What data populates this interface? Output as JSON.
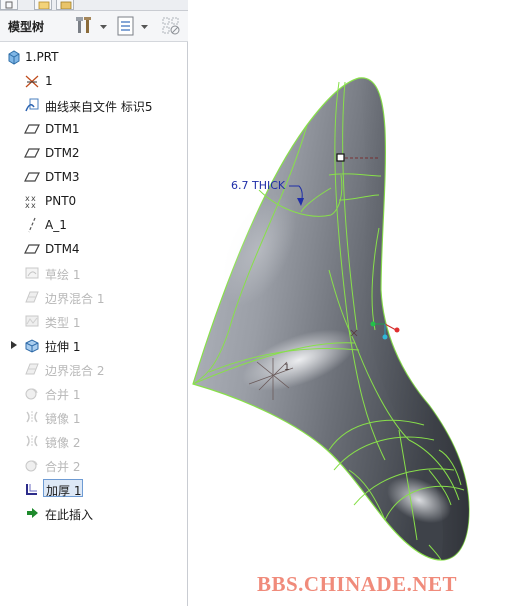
{
  "tree_panel": {
    "title": "模型树",
    "toolbar_icons": [
      "tools-icon",
      "dropdown-arrow-icon",
      "tree-display-icon",
      "dropdown-arrow-icon",
      "filter-icon"
    ],
    "items": [
      {
        "label": "1.PRT",
        "icon": "part-icon",
        "state": "normal"
      },
      {
        "label": "1",
        "icon": "coordinate-system-icon",
        "state": "normal"
      },
      {
        "label": "曲线来自文件 标识5",
        "icon": "curve-from-file-icon",
        "state": "normal"
      },
      {
        "label": "DTM1",
        "icon": "datum-plane-icon",
        "state": "normal"
      },
      {
        "label": "DTM2",
        "icon": "datum-plane-icon",
        "state": "normal"
      },
      {
        "label": "DTM3",
        "icon": "datum-plane-icon",
        "state": "normal"
      },
      {
        "label": "PNT0",
        "icon": "datum-point-icon",
        "state": "normal"
      },
      {
        "label": "A_1",
        "icon": "datum-axis-icon",
        "state": "normal"
      },
      {
        "label": "DTM4",
        "icon": "datum-plane-icon",
        "state": "normal"
      },
      {
        "label": "草绘 1",
        "icon": "sketch-icon",
        "state": "suppressed"
      },
      {
        "label": "边界混合 1",
        "icon": "boundary-blend-icon",
        "state": "suppressed"
      },
      {
        "label": "类型 1",
        "icon": "type-feature-icon",
        "state": "suppressed"
      },
      {
        "label": "拉伸 1",
        "icon": "extrude-icon",
        "state": "normal",
        "expandable": true
      },
      {
        "label": "边界混合 2",
        "icon": "boundary-blend-icon",
        "state": "suppressed"
      },
      {
        "label": "合并 1",
        "icon": "merge-icon",
        "state": "suppressed"
      },
      {
        "label": "镜像 1",
        "icon": "mirror-icon",
        "state": "suppressed"
      },
      {
        "label": "镜像 2",
        "icon": "mirror-icon",
        "state": "suppressed"
      },
      {
        "label": "合并 2",
        "icon": "merge-icon",
        "state": "suppressed"
      },
      {
        "label": "加厚 1",
        "icon": "thicken-icon",
        "state": "selected"
      },
      {
        "label": "在此插入",
        "icon": "insert-here-arrow-icon",
        "state": "normal"
      }
    ]
  },
  "viewport": {
    "dimension_label": "6.7 THICK",
    "csys_label": "1",
    "watermark": "BBS.CHINADE.NET"
  },
  "colors": {
    "edge_highlight": "#88e04a",
    "surface_dark": "#4c5058",
    "surface_light": "#d6d9de",
    "dimension_text": "#1f2ea8",
    "watermark": "#f08b7b",
    "selection_fill": "#dde8f6"
  }
}
